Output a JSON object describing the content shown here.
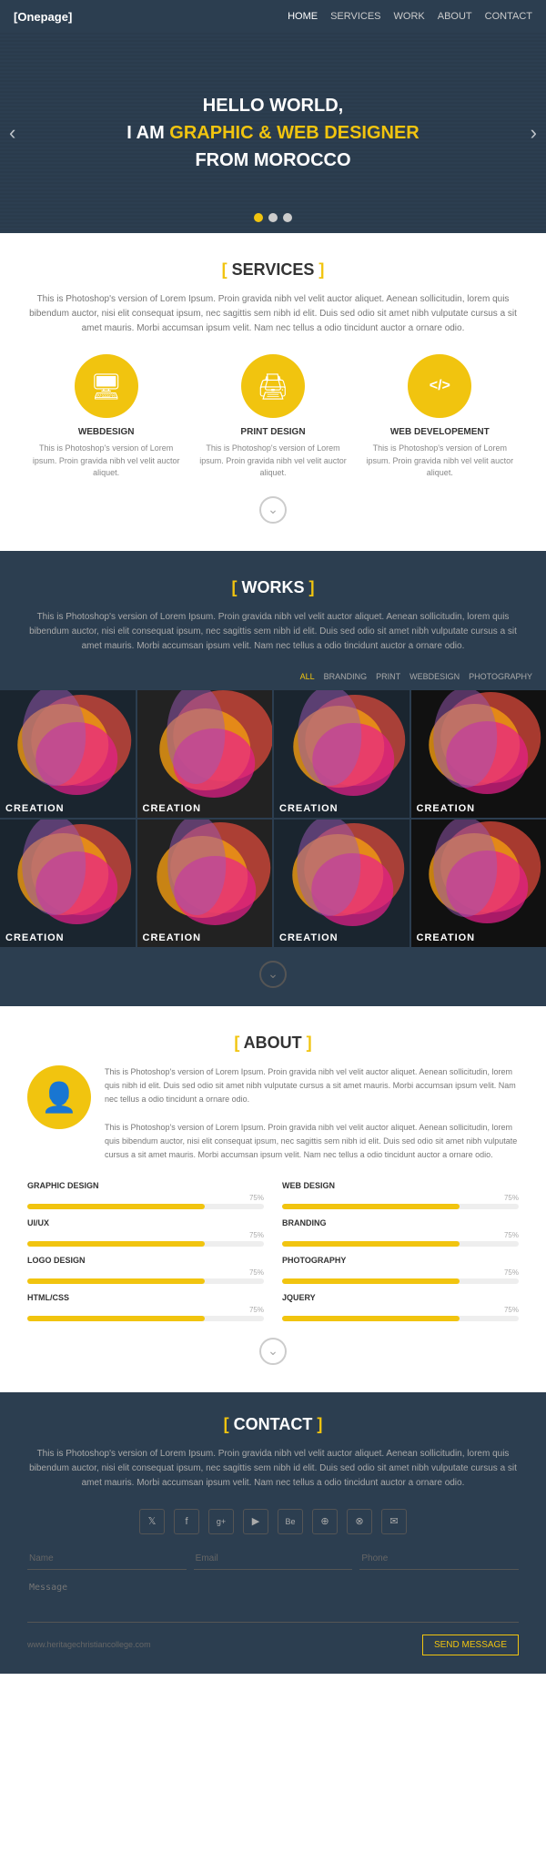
{
  "nav": {
    "logo": "[Onepage]",
    "links": [
      {
        "label": "HOME",
        "active": true
      },
      {
        "label": "SERVICES",
        "active": false
      },
      {
        "label": "WORK",
        "active": false
      },
      {
        "label": "ABOUT",
        "active": false
      },
      {
        "label": "CONTACT",
        "active": false
      }
    ]
  },
  "hero": {
    "line1": "HELLO WORLD,",
    "line2_pre": "I AM ",
    "line2_highlight": "GRAPHIC & WEB DESIGNER",
    "line3": "FROM MOROCCO",
    "dots": 3,
    "active_dot": 0
  },
  "services": {
    "title_bracket_open": "[",
    "title": "SERVICES",
    "title_bracket_close": "]",
    "description": "This is Photoshop's version  of Lorem Ipsum. Proin gravida nibh vel velit auctor aliquet. Aenean sollicitudin, lorem quis bibendum auctor,\nnisi elit consequat ipsum, nec sagittis sem nibh id elit. Duis sed odio sit amet nibh vulputate cursus a sit amet mauris. Morbi accumsan\nipsum velit. Nam nec tellus a odio tincidunt auctor a ornare odio.",
    "items": [
      {
        "icon": "🖥",
        "name": "WEBDESIGN",
        "desc": "This is Photoshop's version  of Lorem ipsum. Proin gravida nibh vel velit auctor aliquet."
      },
      {
        "icon": "🖨",
        "name": "PRINT DESIGN",
        "desc": "This is Photoshop's version  of Lorem ipsum. Proin gravida nibh vel velit auctor aliquet."
      },
      {
        "icon": "</>",
        "name": "WEB DEVELOPEMENT",
        "desc": "This is Photoshop's version  of Lorem ipsum. Proin gravida nibh vel velit auctor aliquet."
      }
    ]
  },
  "works": {
    "title_bracket_open": "[",
    "title": "WORKS",
    "title_bracket_close": "]",
    "description": "This is Photoshop's version  of Lorem Ipsum. Proin gravida nibh vel velit auctor aliquet. Aenean sollicitudin, lorem quis bibendum auctor,\nnisi elit consequat ipsum, nec sagittis sem nibh id elit. Duis sed odio sit amet nibh vulputate cursus a sit amet mauris. Morbi accumsan\nipsum velit. Nam nec tellus a odio tincidunt auctor a ornare odio.",
    "filters": [
      {
        "label": "ALL",
        "active": true
      },
      {
        "label": "BRANDING",
        "active": false
      },
      {
        "label": "PRINT",
        "active": false
      },
      {
        "label": "WEBDESIGN",
        "active": false
      },
      {
        "label": "PHOTOGRAPHY",
        "active": false
      }
    ],
    "items": [
      {
        "label": "CREATION"
      },
      {
        "label": "CREATION"
      },
      {
        "label": "CREATION"
      },
      {
        "label": "CREATION"
      },
      {
        "label": "CREATION"
      },
      {
        "label": "CREATION"
      },
      {
        "label": "CREATION"
      },
      {
        "label": "CREAtION"
      }
    ]
  },
  "about": {
    "title_bracket_open": "[",
    "title": "ABOUT",
    "title_bracket_close": "]",
    "text1": "This is Photoshop's version  of Lorem Ipsum. Proin gravida nibh vel velit auctor aliquet. Aenean sollicitudin, lorem quis nibh id elit. Duis sed odio sit amet nibh vulputate cursus a sit amet mauris. Morbi accumsan ipsum velit. Nam nec tellus a odio tincidunt a ornare odio.",
    "text2": "This is Photoshop's version  of Lorem Ipsum. Proin gravida nibh vel velit auctor aliquet. Aenean sollicitudin, lorem quis bibendum auctor, nisi elit consequat ipsum, nec sagittis sem nibh id elit. Duis sed odio sit amet nibh vulputate cursus a sit amet mauris. Morbi accumsan ipsum velit. Nam nec tellus a odio tincidunt auctor a ornare odio.",
    "skills": [
      {
        "name": "GRAPHIC DESIGN",
        "pct": 75
      },
      {
        "name": "WEB DESIGN",
        "pct": 75
      },
      {
        "name": "UI/UX",
        "pct": 75
      },
      {
        "name": "BRANDING",
        "pct": 75
      },
      {
        "name": "LOGO DESIGN",
        "pct": 75
      },
      {
        "name": "PHOTOGRAPHY",
        "pct": 75
      },
      {
        "name": "HTML/CSS",
        "pct": 75
      },
      {
        "name": "JQUERY",
        "pct": 75
      }
    ]
  },
  "contact": {
    "title_bracket_open": "[",
    "title": "CONTACT",
    "title_bracket_close": "]",
    "description": "This is Photoshop's version  of Lorem Ipsum. Proin gravida nibh vel velit auctor aliquet. Aenean sollicitudin, lorem quis bibendum auctor,\nnisi elit consequat ipsum, nec sagittis sem nibh id elit. Duis sed odio sit amet nibh vulputate cursus a sit amet mauris. Morbi accumsan\nipsum velit. Nam nec tellus a odio tincidunt auctor a ornare odio.",
    "social_icons": [
      "𝕏",
      "f",
      "g+",
      "▶",
      "Be",
      "⊕",
      "⊗",
      "✉"
    ],
    "form": {
      "name_placeholder": "Name",
      "email_placeholder": "Email",
      "phone_placeholder": "Phone",
      "message_placeholder": "Message",
      "url": "www.heritagechristiancollege.com",
      "send_label": "SEND MESSAGE"
    }
  },
  "accent_color": "#f1c40f",
  "dark_bg": "#2c3e50"
}
